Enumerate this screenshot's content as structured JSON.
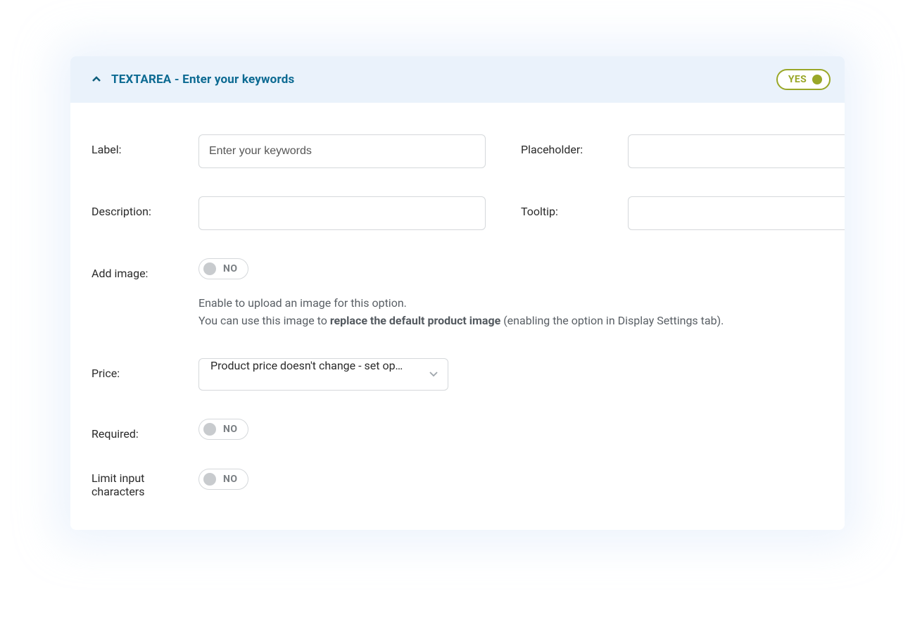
{
  "header": {
    "title": "TEXTAREA - Enter your keywords",
    "badge": "YES"
  },
  "fields": {
    "label": {
      "label": "Label:",
      "value": "Enter your keywords"
    },
    "placeholder": {
      "label": "Placeholder:",
      "value": ""
    },
    "description": {
      "label": "Description:",
      "value": ""
    },
    "tooltip": {
      "label": "Tooltip:",
      "value": ""
    },
    "addImage": {
      "label": "Add image:",
      "toggle": "NO",
      "help1": "Enable to upload an image for this option.",
      "help2a": "You can use this image to ",
      "help2b": "replace the default product image",
      "help2c": " (enabling the option in Display Settings tab)."
    },
    "price": {
      "label": "Price:",
      "value": "Product price doesn't change - set op…"
    },
    "required": {
      "label": "Required:",
      "toggle": "NO"
    },
    "limitChars": {
      "label": "Limit input characters",
      "toggle": "NO"
    }
  }
}
